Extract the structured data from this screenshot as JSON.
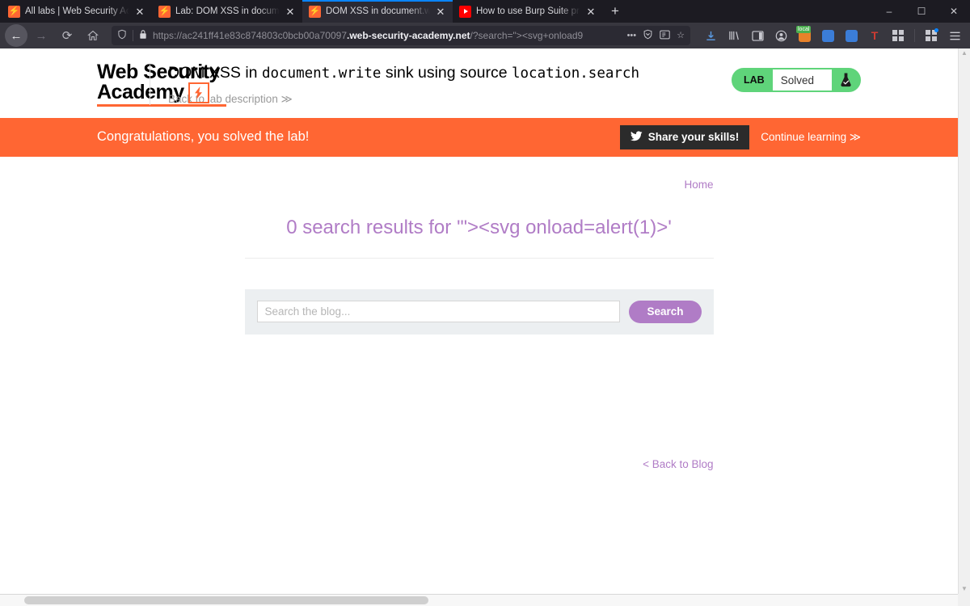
{
  "browser": {
    "tabs": [
      {
        "title": "All labs | Web Security Academy",
        "favicon": "psw-bolt-icon",
        "active": false
      },
      {
        "title": "Lab: DOM XSS in document.write",
        "favicon": "psw-bolt-icon",
        "active": false
      },
      {
        "title": "DOM XSS in document.write sink",
        "favicon": "psw-bolt-icon",
        "active": true
      },
      {
        "title": "How to use Burp Suite projects",
        "favicon": "youtube-icon",
        "active": false
      }
    ],
    "new_tab_label": "+",
    "window_controls": {
      "minimize": "–",
      "maximize": "❐",
      "close": "✕"
    },
    "nav": {
      "back": "←",
      "forward": "→",
      "reload": "⟳",
      "home": "⌂"
    },
    "url": {
      "prefix": "https://ac241ff41e83c874803c0bcb00a70097",
      "host": ".web-security-academy.net",
      "path": "/?search=\"><svg+onload9",
      "shield_icon": "⛨",
      "lock_icon": "ὑ2",
      "more_icon": "•••",
      "pocket_icon": "shield-pocket-icon",
      "bookmark_icon": "☆"
    },
    "toolbar_icons": [
      "downloads-icon",
      "library-icon",
      "sidebar-icon",
      "account-icon",
      "local-extension-icon",
      "extension-blue-1-icon",
      "extension-blue-2-icon",
      "text-tool-icon",
      "apps-grid-icon",
      "extensions-puzzle-icon",
      "app-menu-icon"
    ],
    "local_badge": "local"
  },
  "lab": {
    "logo_line1": "Web Security",
    "logo_line2": "Academy",
    "title_parts": [
      {
        "text": "DOM XSS in ",
        "mono": false
      },
      {
        "text": "document.write",
        "mono": true
      },
      {
        "text": " sink using source ",
        "mono": false
      },
      {
        "text": "location.search",
        "mono": true
      }
    ],
    "back_link": "Back to lab description ≫",
    "status_key": "LAB",
    "status_value": "Solved",
    "status_icon": "flask-icon",
    "status_color": "#5fd47a"
  },
  "banner": {
    "message": "Congratulations, you solved the lab!",
    "share_label": "Share your skills!",
    "share_icon": "twitter-bird-icon",
    "continue_label": "Continue learning ≫",
    "color": "#ff6633"
  },
  "blog": {
    "breadcrumb_home": "Home",
    "results_heading": "0 search results for '\"><svg onload=alert(1)>'",
    "search_placeholder": "Search the blog...",
    "search_value": "",
    "search_button": "Search",
    "back_to_blog": "< Back to Blog",
    "accent_color": "#b07cc6"
  }
}
